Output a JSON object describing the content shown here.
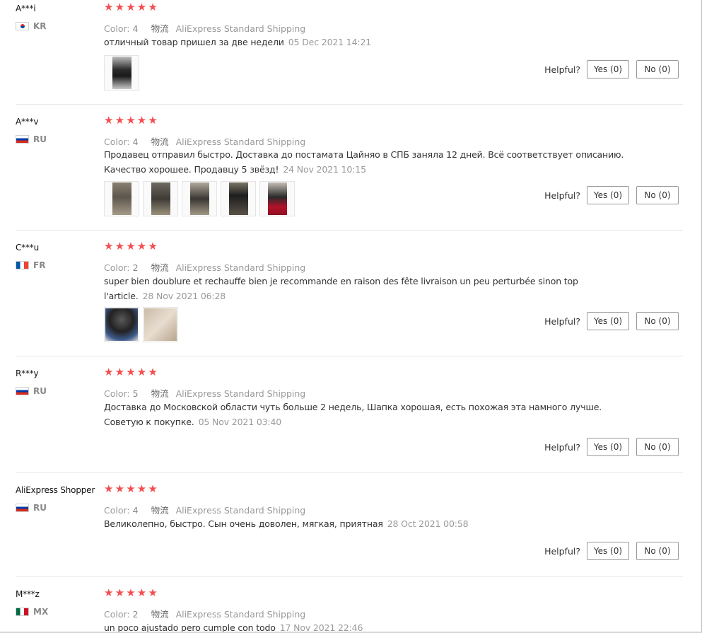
{
  "labels": {
    "color": "Color:",
    "shipping": "物流",
    "helpful": "Helpful?"
  },
  "reviews": [
    {
      "user": "A***i",
      "country": "KR",
      "flag_colors": [
        "#ffffff",
        "#cd2e3a",
        "#0047a0"
      ],
      "rating": 5,
      "color_value": "4",
      "shipping_method": "AliExpress Standard Shipping",
      "text": "отличный товар пришел за две недели",
      "date": "05 Dec 2021 14:21",
      "photo_count": 1,
      "yes": "Yes (0)",
      "no": "No (0)"
    },
    {
      "user": "A***v",
      "country": "RU",
      "flag_colors": [
        "#ffffff",
        "#0039a6",
        "#d52b1e"
      ],
      "rating": 5,
      "color_value": "4",
      "shipping_method": "AliExpress Standard Shipping",
      "text": "Продавец отправил быстро. Доставка до постамата Цайняо в СПБ заняла 12 дней. Всё соответствует описанию. Качество хорошее. Продавцу 5 звёзд!",
      "date": "24 Nov 2021 10:15",
      "photo_count": 5,
      "yes": "Yes (0)",
      "no": "No (0)"
    },
    {
      "user": "C***u",
      "country": "FR",
      "flag_colors": [
        "#0055a4",
        "#ffffff",
        "#ef4135"
      ],
      "rating": 5,
      "color_value": "2",
      "shipping_method": "AliExpress Standard Shipping",
      "text": "super bien doublure et rechauffe bien je recommande en raison des fête livraison un peu perturbée sinon top l'article.",
      "date": "28 Nov 2021 06:28",
      "photo_count": 2,
      "yes": "Yes (0)",
      "no": "No (0)"
    },
    {
      "user": "R***y",
      "country": "RU",
      "flag_colors": [
        "#ffffff",
        "#0039a6",
        "#d52b1e"
      ],
      "rating": 5,
      "color_value": "5",
      "shipping_method": "AliExpress Standard Shipping",
      "text": "Доставка до Московской области чуть больше 2 недель, Шапка хорошая, есть похожая эта намного лучше. Советую к покупке.",
      "date": "05 Nov 2021 03:40",
      "photo_count": 0,
      "yes": "Yes (0)",
      "no": "No (0)"
    },
    {
      "user": "AliExpress Shopper",
      "country": "RU",
      "flag_colors": [
        "#ffffff",
        "#0039a6",
        "#d52b1e"
      ],
      "rating": 5,
      "color_value": "4",
      "shipping_method": "AliExpress Standard Shipping",
      "text": "Великолепно, быстро. Сын очень доволен, мягкая, приятная",
      "date": "28 Oct 2021 00:58",
      "photo_count": 0,
      "yes": "Yes (0)",
      "no": "No (0)"
    },
    {
      "user": "M***z",
      "country": "MX",
      "flag_colors": [
        "#006847",
        "#ffffff",
        "#ce1126"
      ],
      "rating": 5,
      "color_value": "2",
      "shipping_method": "AliExpress Standard Shipping",
      "text": "un poco ajustado pero cumple con todo",
      "date": "17 Nov 2021 22:46",
      "photo_count": 0,
      "yes": "",
      "no": ""
    }
  ]
}
